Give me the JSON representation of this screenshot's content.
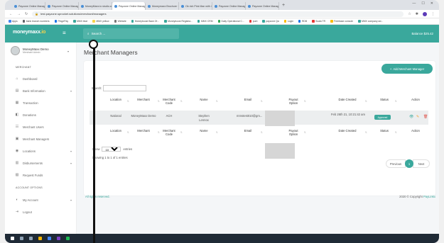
{
  "browser": {
    "tabs": [
      {
        "label": "Payzone Online Management ·",
        "active": false
      },
      {
        "label": "Payzone Online Management ·",
        "active": false
      },
      {
        "label": "MoneyMaxx.io studio.com · abc",
        "active": false
      },
      {
        "label": "Payzone Online Management ·",
        "active": true
      },
      {
        "label": "Moneymaxx Brochure · B2.1 ·",
        "active": false
      },
      {
        "label": "Ok rich Pink Man with 4.3K Re",
        "active": false
      },
      {
        "label": "Payzone Online Management ·",
        "active": false
      },
      {
        "label": "Payzone Online Management ·",
        "active": false
      }
    ],
    "url": "test.payzone.sprocket.solutions/merchant/managers",
    "bookmarks": [
      {
        "label": "Apps",
        "color": "#4285f4"
      },
      {
        "label": "bank branch numbers",
        "color": "#5f6368"
      },
      {
        "label": "PingePay",
        "color": "#1a73e8"
      },
      {
        "label": "MMX blue",
        "color": "#3aa89c"
      },
      {
        "label": "MMX yellow",
        "color": "#f7d44c"
      },
      {
        "label": "Website",
        "color": "#777777"
      },
      {
        "label": "Moneyboost Back Of...",
        "color": "#3aa89c"
      },
      {
        "label": "Moneyboost Registra...",
        "color": "#3aa89c"
      },
      {
        "label": "MMX CRM",
        "color": "#3aa89c"
      },
      {
        "label": "Daily Operational C...",
        "color": "#34a853"
      },
      {
        "label": "punt",
        "color": "#e53935"
      },
      {
        "label": "payzone Qa",
        "color": "#3aa89c"
      },
      {
        "label": "Login",
        "color": "#fbbc05"
      },
      {
        "label": "RDB",
        "color": "#1a73e8"
      },
      {
        "label": "Scala TR",
        "color": "#e53935"
      },
      {
        "label": "Freebase console",
        "color": "#fbbc05"
      },
      {
        "label": "MMX company ad...",
        "color": "#3aa89c"
      }
    ]
  },
  "header": {
    "logo_text": "moneymaxx",
    "logo_sub": ".io",
    "search_placeholder": "Search ...",
    "balance": "Balance $25.42"
  },
  "sidebar": {
    "user_name": "MoneyMaxx Demo",
    "user_role": "Merchant Admin",
    "section_merchant": "MERCHANT",
    "items": [
      {
        "label": "Dashboard",
        "icon": "⌂",
        "caret": false
      },
      {
        "label": "Bank Information",
        "icon": "▤",
        "caret": true
      },
      {
        "label": "Transaction",
        "icon": "▦",
        "caret": false
      },
      {
        "label": "Donations",
        "icon": "◧",
        "caret": false
      },
      {
        "label": "Merchant Users",
        "icon": "☷",
        "caret": false
      },
      {
        "label": "Merchant Managers",
        "icon": "▣",
        "caret": false
      },
      {
        "label": "Locations",
        "icon": "◉",
        "caret": true
      },
      {
        "label": "Disbursements",
        "icon": "▥",
        "caret": true
      },
      {
        "label": "Request Funds",
        "icon": "▧",
        "caret": false
      }
    ],
    "section_account": "ACCOUNT OPTIONS",
    "account_items": [
      {
        "label": "My Account",
        "icon": "◐",
        "caret": true
      },
      {
        "label": "Logout",
        "icon": "⇥",
        "caret": false
      }
    ]
  },
  "main": {
    "page_title": "Merchant Managers",
    "add_button": "Add Merchant Manager",
    "search_label": "Search:",
    "columns": [
      "Location",
      "Merchant",
      "Merchant Code",
      "Name",
      "Email",
      "Payout Option",
      "Date Created",
      "Status",
      "Action"
    ],
    "rows": [
      {
        "location": "National",
        "merchant": "MoneyMaxx Demo",
        "merchant_code": "ACH",
        "name": "Stephen Lennox",
        "email": "mmstest010@gm...",
        "payout": "",
        "date": "Feb 26th 21, 10:21:42 am",
        "status": "Approved"
      }
    ],
    "show_label": "Show",
    "show_value": "10",
    "entries_label": "entries",
    "info": "Showing 1 to 1 of 1 entries",
    "prev": "Previous",
    "page": "1",
    "next": "Next"
  },
  "footer": {
    "left_prefix": "All rights reserved.",
    "right_prefix": "2020 © Copyright",
    "right_link": "PayLinkx"
  }
}
